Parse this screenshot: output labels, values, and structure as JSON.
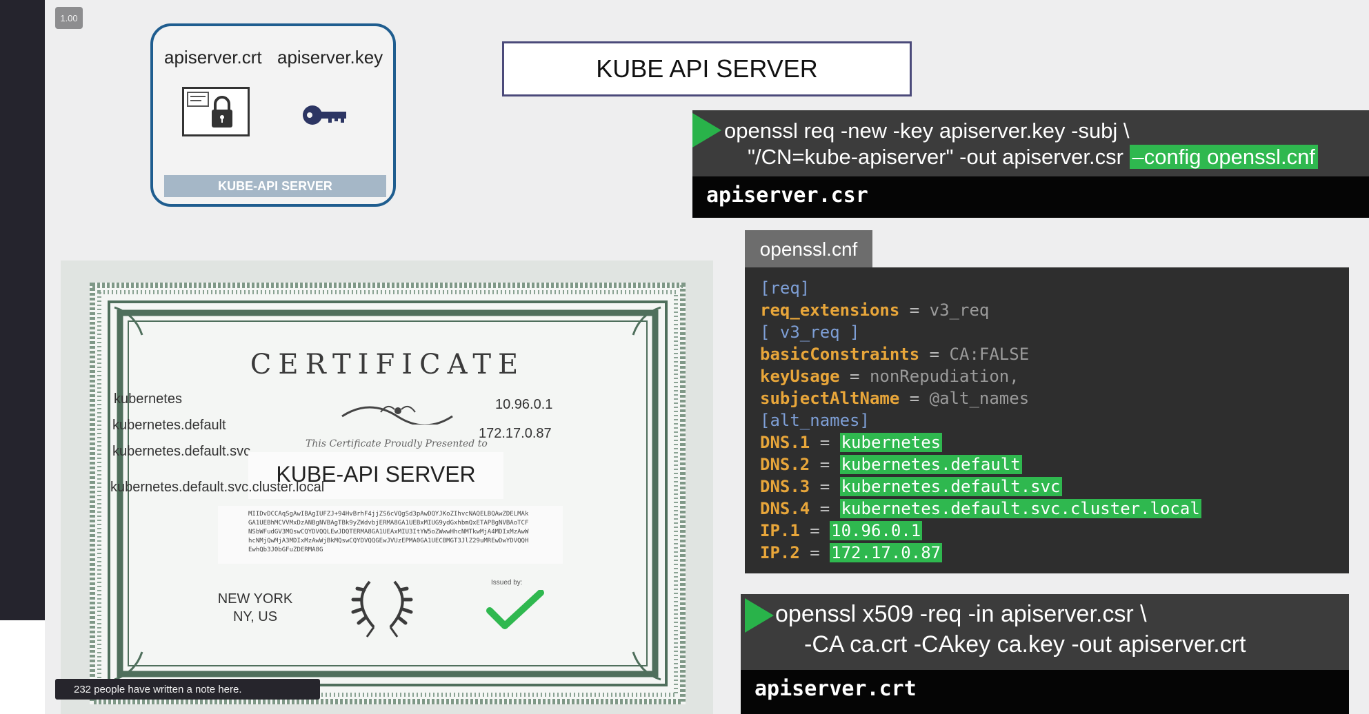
{
  "zoom_badge": "1.00",
  "key_card": {
    "crt_label": "apiserver.crt",
    "key_label": "apiserver.key",
    "footer": "KUBE-API SERVER"
  },
  "title": "KUBE API SERVER",
  "command1": {
    "line1": "openssl req -new -key apiserver.key -subj \\",
    "line2_prefix": "\"/CN=kube-apiserver\" -out apiserver.csr ",
    "line2_highlight": "–config openssl.cnf",
    "output": "apiserver.csr"
  },
  "cnf": {
    "tab": "openssl.cnf",
    "req_section": "[req]",
    "req_ext_key": "req_extensions",
    "req_ext_val": "v3_req",
    "v3_section": "[ v3_req ]",
    "basic_key": "basicConstraints",
    "basic_val": "CA:FALSE",
    "keyusage_key": "keyUsage",
    "keyusage_val": "nonRepudiation,",
    "san_key": "subjectAltName",
    "san_val": "@alt_names",
    "alt_section": "[alt_names]",
    "entries": [
      {
        "key": "DNS.1",
        "value": "kubernetes"
      },
      {
        "key": "DNS.2",
        "value": "kubernetes.default"
      },
      {
        "key": "DNS.3",
        "value": "kubernetes.default.svc"
      },
      {
        "key": "DNS.4",
        "value": "kubernetes.default.svc.cluster.local"
      },
      {
        "key": "IP.1",
        "value": "10.96.0.1"
      },
      {
        "key": "IP.2",
        "value": "172.17.0.87"
      }
    ]
  },
  "command2": {
    "line1": "openssl x509 -req -in apiserver.csr \\",
    "line2": "-CA ca.crt -CAkey ca.key -out apiserver.crt",
    "output": "apiserver.crt"
  },
  "certificate": {
    "title": "CERTIFICATE",
    "names": [
      "kubernetes",
      "kubernetes.default",
      "kubernetes.default.svc",
      "kubernetes.default.svc.cluster.local"
    ],
    "ips": [
      "10.96.0.1",
      "172.17.0.87"
    ],
    "presented": "This Certificate Proudly Presented to",
    "name": "KUBE-API SERVER",
    "hash": "MIIDvDCCAqSgAwIBAgIUFZJ+94HvBrhF4jjZS6cVQgSd3pAwDQYJKoZIhvcNAQELBQAwZDELMAkGA1UEBhMCVVMxDzANBgNVBAgTBk9yZWdvbjERMA8GA1UEBxMIUG9ydGxhbmQxETAPBgNVBAoTCFNSbWFudGV3MQswCQYDVQQLEwJDQTERMA8GA1UEAxMIU3ItYW5oZWwwHhcNMTkwMjA4MDIxMzAwWhcNMjQwMjA3MDIxMzAwWjBkMQswCQYDVQQGEwJVUzEPMA0GA1UECBMGT3JlZ29uMREwDwYDVQQHEwhQb3J0bGFuZDERMA8G",
    "location_line1": "NEW YORK",
    "location_line2": "NY, US",
    "issued_by": "Issued by:"
  },
  "note_bar": "232 people have written a note here.",
  "colors": {
    "accent_green": "#2fb84f",
    "card_border": "#1f5d8f",
    "terminal_bg": "#3c3c3c",
    "cert_green": "#4f6f5c"
  }
}
